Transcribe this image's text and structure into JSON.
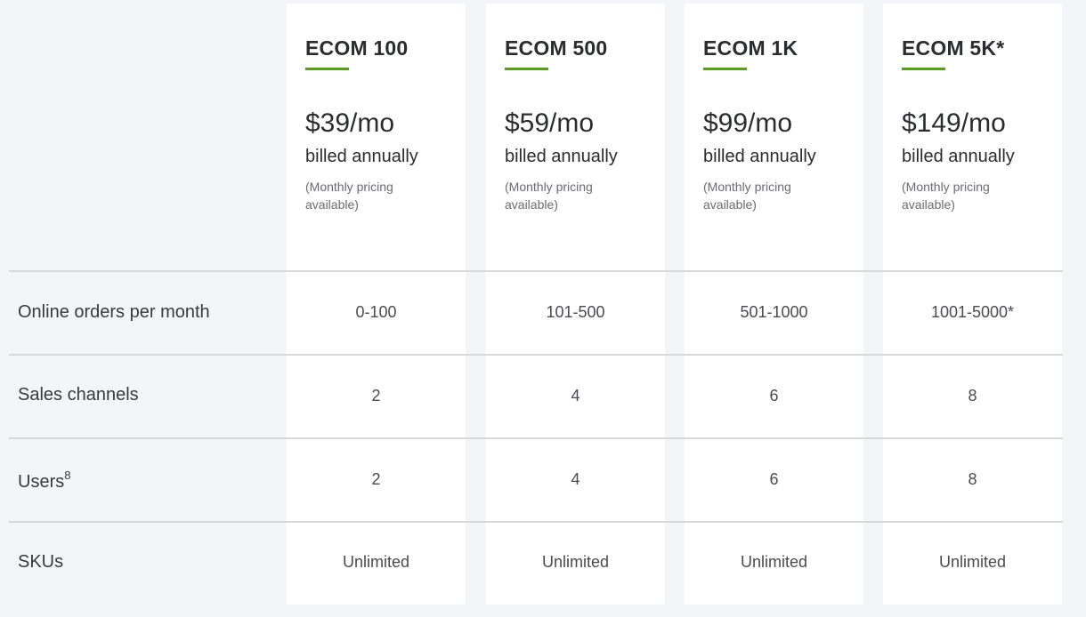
{
  "brand": {
    "accent_color": "#53a318",
    "background_color": "#f4f5f8"
  },
  "plans": [
    {
      "name": "ECOM 100",
      "price": "$39/mo",
      "billing": "billed annually",
      "note": "(Monthly pricing available)"
    },
    {
      "name": "ECOM 500",
      "price": "$59/mo",
      "billing": "billed annually",
      "note": "(Monthly pricing available)"
    },
    {
      "name": "ECOM 1K",
      "price": "$99/mo",
      "billing": "billed annually",
      "note": "(Monthly pricing available)"
    },
    {
      "name": "ECOM 5K*",
      "price": "$149/mo",
      "billing": "billed annually",
      "note": "(Monthly pricing available)"
    }
  ],
  "features": [
    {
      "label": "Online orders per month",
      "sup": "",
      "values": [
        "0-100",
        "101-500",
        "501-1000",
        "1001-5000*"
      ]
    },
    {
      "label": "Sales channels",
      "sup": "",
      "values": [
        "2",
        "4",
        "6",
        "8"
      ]
    },
    {
      "label": "Users",
      "sup": "8",
      "values": [
        "2",
        "4",
        "6",
        "8"
      ]
    },
    {
      "label": "SKUs",
      "sup": "",
      "values": [
        "Unlimited",
        "Unlimited",
        "Unlimited",
        "Unlimited"
      ]
    }
  ]
}
